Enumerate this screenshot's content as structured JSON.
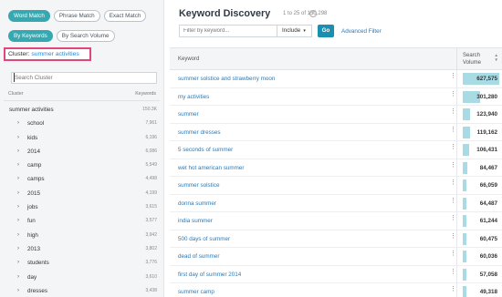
{
  "toggles": {
    "word_match": "Word Match",
    "phrase_match": "Phrase Match",
    "exact_match": "Exact Match",
    "by_keywords": "By Keywords",
    "by_search_volume": "By Search Volume"
  },
  "cluster": {
    "label": "Cluster:",
    "value": "summer activities"
  },
  "cluster_search": {
    "placeholder": "Search Cluster"
  },
  "tree": {
    "header_cluster": "Cluster",
    "header_keywords": "Keywords",
    "root": {
      "name": "summer activities",
      "count": "150.3K"
    },
    "items": [
      {
        "name": "school",
        "count": "7,961"
      },
      {
        "name": "kids",
        "count": "6,196"
      },
      {
        "name": "2014",
        "count": "6,086"
      },
      {
        "name": "camp",
        "count": "5,549"
      },
      {
        "name": "camps",
        "count": "4,498"
      },
      {
        "name": "2015",
        "count": "4,199"
      },
      {
        "name": "jobs",
        "count": "3,615"
      },
      {
        "name": "fun",
        "count": "3,577"
      },
      {
        "name": "high",
        "count": "3,942"
      },
      {
        "name": "2013",
        "count": "3,802"
      },
      {
        "name": "students",
        "count": "3,776"
      },
      {
        "name": "day",
        "count": "3,610"
      },
      {
        "name": "dresses",
        "count": "3,438"
      }
    ]
  },
  "main": {
    "title": "Keyword Discovery",
    "count_text": "1 to 25 of 150,298",
    "help_icon": "?",
    "filter_placeholder": "Filter by keyword...",
    "include_label": "Include",
    "go_label": "Go",
    "advanced_filter": "Advanced Filter",
    "col_keyword": "Keyword",
    "col_volume_1": "Search",
    "col_volume_2": "Volume"
  },
  "rows": [
    {
      "keyword": "summer solstice and strawberry moon",
      "volume": "627,575",
      "volume_value": 627575
    },
    {
      "keyword": "my activities",
      "volume": "301,280",
      "volume_value": 301280
    },
    {
      "keyword": "summer",
      "volume": "123,940",
      "volume_value": 123940
    },
    {
      "keyword": "summer dresses",
      "volume": "119,162",
      "volume_value": 119162
    },
    {
      "keyword": "5 seconds of summer",
      "volume": "106,431",
      "volume_value": 106431
    },
    {
      "keyword": "wet hot american summer",
      "volume": "84,467",
      "volume_value": 84467
    },
    {
      "keyword": "summer solstice",
      "volume": "66,059",
      "volume_value": 66059
    },
    {
      "keyword": "donna summer",
      "volume": "64,487",
      "volume_value": 64487
    },
    {
      "keyword": "india summer",
      "volume": "61,244",
      "volume_value": 61244
    },
    {
      "keyword": "500 days of summer",
      "volume": "60,475",
      "volume_value": 60475
    },
    {
      "keyword": "dead of summer",
      "volume": "60,036",
      "volume_value": 60036
    },
    {
      "keyword": "first day of summer 2014",
      "volume": "57,058",
      "volume_value": 57058
    },
    {
      "keyword": "summer camp",
      "volume": "49,318",
      "volume_value": 49318
    }
  ],
  "colors": {
    "accent": "#36a8b2",
    "highlight": "#e0467a",
    "link": "#2a7ab8",
    "bar": "#a8dbe3"
  }
}
